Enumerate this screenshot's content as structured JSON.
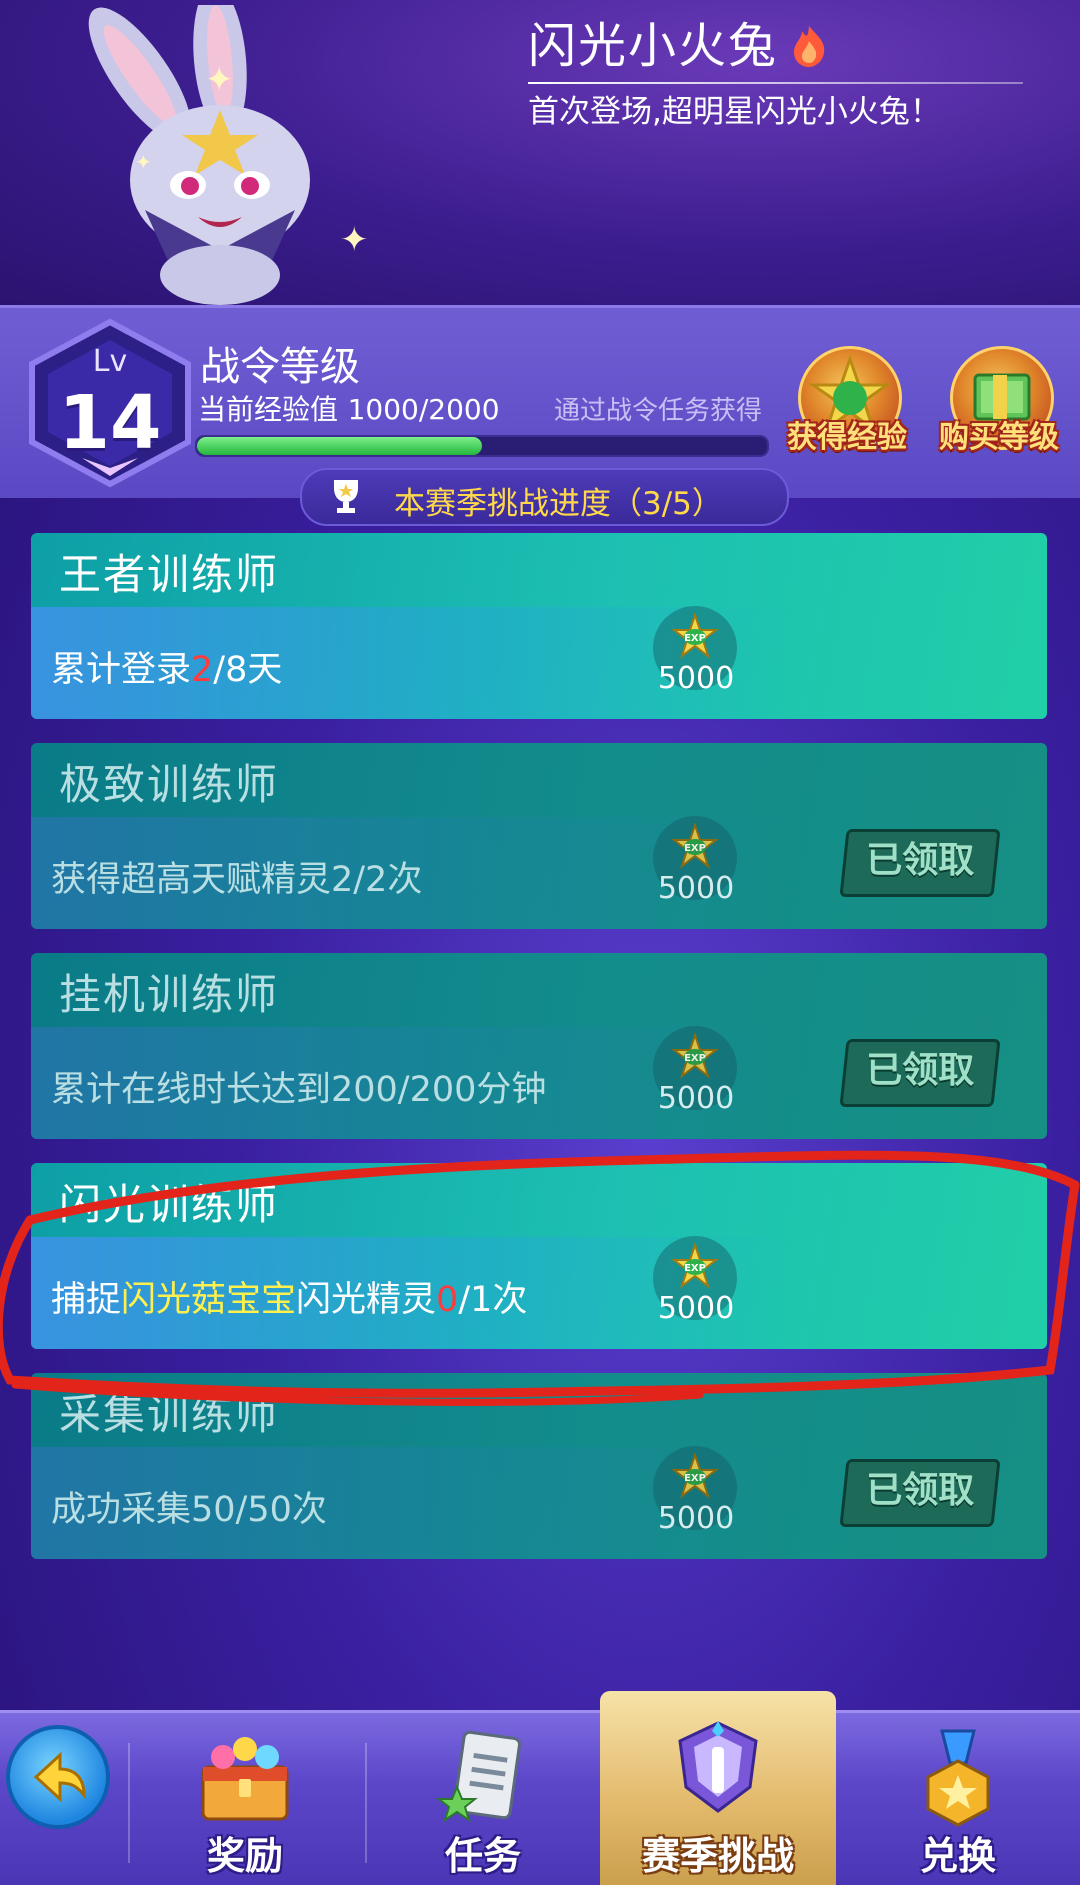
{
  "header": {
    "pet_name": "闪光小火兔",
    "pet_description": "首次登场,超明星闪光小火兔！"
  },
  "level": {
    "lv_label": "Lv",
    "lv_value": "14",
    "title": "战令等级",
    "exp_label": "当前经验值",
    "exp_value": "1000/2000",
    "exp_progress": 0.5,
    "hint": "通过战令任务获得",
    "get_exp_label": "获得经验",
    "buy_level_label": "购买等级"
  },
  "season": {
    "progress_text": "本赛季挑战进度（3/5）"
  },
  "tasks": [
    {
      "title": "王者训练师",
      "desc_pre": "累计登录",
      "desc_hl": "2",
      "desc_post": "/8天",
      "exp_icon": "EXP",
      "exp": "5000",
      "claimed": false
    },
    {
      "title": "极致训练师",
      "desc": "获得超高天赋精灵2/2次",
      "exp_icon": "EXP",
      "exp": "5000",
      "claimed": true,
      "claimed_label": "已领取"
    },
    {
      "title": "挂机训练师",
      "desc": "累计在线时长达到200/200分钟",
      "exp_icon": "EXP",
      "exp": "5000",
      "claimed": true,
      "claimed_label": "已领取"
    },
    {
      "title": "闪光训练师",
      "desc_pre": "捕捉",
      "desc_hl_yellow": "闪光菇宝宝",
      "desc_mid": "闪光精灵",
      "desc_hl": "0",
      "desc_post": "/1次",
      "exp_icon": "EXP",
      "exp": "5000",
      "claimed": false
    },
    {
      "title": "采集训练师",
      "desc": "成功采集50/50次",
      "exp_icon": "EXP",
      "exp": "5000",
      "claimed": true,
      "claimed_label": "已领取"
    }
  ],
  "nav": {
    "back_icon": "back-arrow-icon",
    "items": [
      {
        "label": "奖励",
        "icon": "treasure-chest-icon"
      },
      {
        "label": "任务",
        "icon": "task-list-icon"
      },
      {
        "label": "赛季挑战",
        "icon": "season-emblem-icon",
        "active": true
      },
      {
        "label": "兑换",
        "icon": "medal-icon"
      }
    ]
  },
  "colors": {
    "accent_yellow": "#ffd94a",
    "highlight_red": "#ff3c3c",
    "card_active": "#1dbfb2",
    "card_done": "#138c8c",
    "annotation_red": "#e3241b"
  }
}
